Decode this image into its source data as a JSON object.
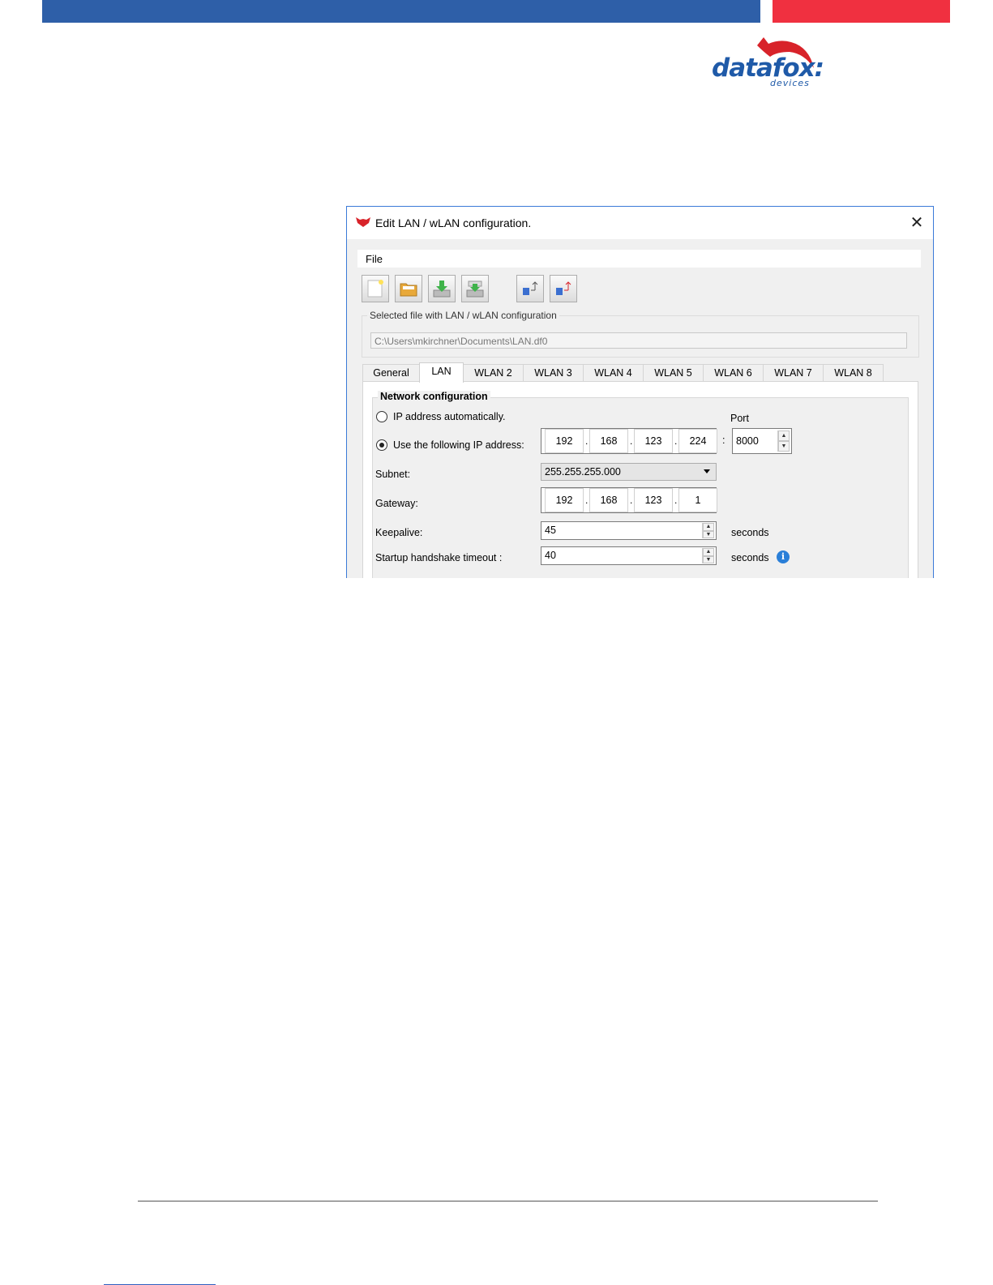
{
  "brand": {
    "logo_word": "datafox:",
    "logo_sub": "devices",
    "blue": "#2e5fa8",
    "red": "#f03040"
  },
  "dialog": {
    "title": "Edit LAN / wLAN configuration.",
    "close_glyph": "✕",
    "menu": {
      "file": "File"
    },
    "toolbar": [
      "new-file-icon",
      "open-folder-icon",
      "download-icon",
      "upload-icon",
      "import-config-icon",
      "export-config-icon"
    ],
    "file_group": {
      "label": "Selected file with LAN / wLAN configuration",
      "path": "C:\\Users\\mkirchner\\Documents\\LAN.df0"
    },
    "tabs": [
      "General",
      "LAN",
      "WLAN 2",
      "WLAN 3",
      "WLAN 4",
      "WLAN 5",
      "WLAN 6",
      "WLAN 7",
      "WLAN 8"
    ],
    "active_tab": "LAN",
    "network": {
      "group_label": "Network configuration",
      "auto_ip_label": "IP address automatically.",
      "auto_ip_selected": false,
      "manual_ip_label": "Use the following IP address:",
      "manual_ip_selected": true,
      "ip": [
        "192",
        "168",
        "123",
        "224"
      ],
      "port_label": "Port",
      "port_sep": ":",
      "port": "8000",
      "subnet_label": "Subnet:",
      "subnet": "255.255.255.000",
      "gateway_label": "Gateway:",
      "gateway": [
        "192",
        "168",
        "123",
        "1"
      ],
      "keepalive_label": "Keepalive:",
      "keepalive": "45",
      "keepalive_unit": "seconds",
      "handshake_label": "Startup handshake timeout :",
      "handshake": "40",
      "handshake_unit": "seconds",
      "info_glyph": "i"
    }
  }
}
